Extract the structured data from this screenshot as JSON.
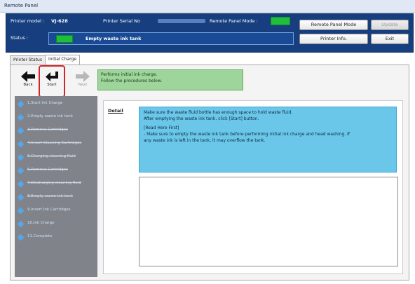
{
  "window": {
    "title": "Remote Panel"
  },
  "header": {
    "printer_model_label": "Printer model :",
    "printer_model_value": "VJ-628",
    "serial_label": "Printer Serial No",
    "panel_mode_label": "Remote Panel Mode :",
    "status_label": "Status :",
    "status_value": "Empty waste ink tank",
    "status_color": "#1fbf3b",
    "buttons": {
      "remote_panel_mode": "Remote Panel Mode",
      "update": "Update",
      "printer_info": "Printer Info.",
      "exit": "Exit"
    }
  },
  "tabs": [
    {
      "label": "Printer Status",
      "active": false
    },
    {
      "label": "Initial Charge",
      "active": true
    }
  ],
  "toolbar": {
    "back": "Back",
    "start": "Start",
    "next": "Next"
  },
  "message": {
    "line1": "Performs initial ink charge.",
    "line2": "Follow the procedures below."
  },
  "steps": [
    {
      "label": "1.Start Ink Charge",
      "strike": false
    },
    {
      "label": "2.Empty waste ink tank",
      "strike": false
    },
    {
      "label": "3.Remove Cartridges",
      "strike": true
    },
    {
      "label": "4.Insert Cleaning Cartridges",
      "strike": true
    },
    {
      "label": "5.Charging cleaning fluid",
      "strike": true
    },
    {
      "label": "6.Remove Cartridges",
      "strike": true
    },
    {
      "label": "7.Discharging cleaning fluid",
      "strike": true
    },
    {
      "label": "8.Empty waste ink tank",
      "strike": true
    },
    {
      "label": "9.Insert Ink Cartridges",
      "strike": false
    },
    {
      "label": "10.Ink Charge",
      "strike": false
    },
    {
      "label": "11.Complete",
      "strike": false
    }
  ],
  "detail": {
    "label": "Detail",
    "line1": "Make sure the waste fluid bottle has enough space to hold waste fluid.",
    "line2": "After emptying the waste ink tank, click [Start] button.",
    "line3": "[Read Here First]",
    "line4": "- Make sure to empty the waste ink tank before performing initial ink charge and head washing. If",
    "line5": "any waste ink is left in the tank, it may overflow the tank."
  }
}
